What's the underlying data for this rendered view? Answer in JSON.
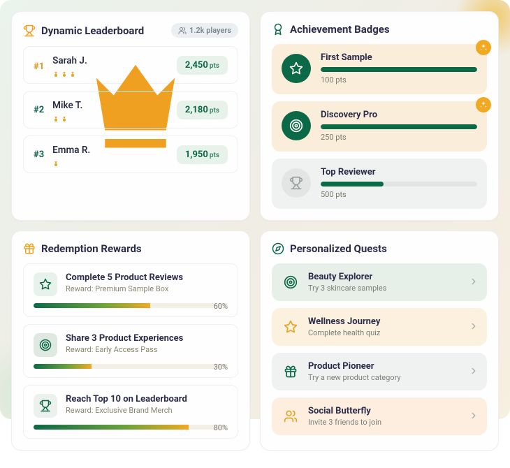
{
  "leaderboard": {
    "title": "Dynamic Leaderboard",
    "players_badge": "1.2k players",
    "pts_unit": "pts",
    "rows": [
      {
        "rank": "#1",
        "name": "Sarah J.",
        "points": "2,450",
        "medals": 3
      },
      {
        "rank": "#2",
        "name": "Mike T.",
        "points": "2,180",
        "medals": 2
      },
      {
        "rank": "#3",
        "name": "Emma R.",
        "points": "1,950",
        "medals": 1
      }
    ]
  },
  "achievements": {
    "title": "Achievement Badges",
    "items": [
      {
        "title": "First Sample",
        "points": "100 pts",
        "progress": 100,
        "claimed": true
      },
      {
        "title": "Discovery Pro",
        "points": "250 pts",
        "progress": 100,
        "claimed": true
      },
      {
        "title": "Top Reviewer",
        "points": "500 pts",
        "progress": 40,
        "claimed": false
      }
    ]
  },
  "rewards": {
    "title": "Redemption Rewards",
    "items": [
      {
        "title": "Complete 5 Product Reviews",
        "sub": "Reward: Premium Sample Box",
        "progress": 60,
        "pct": "60%"
      },
      {
        "title": "Share 3 Product Experiences",
        "sub": "Reward: Early Access Pass",
        "progress": 30,
        "pct": "30%"
      },
      {
        "title": "Reach Top 10 on Leaderboard",
        "sub": "Reward: Exclusive Brand Merch",
        "progress": 80,
        "pct": "80%"
      }
    ]
  },
  "quests": {
    "title": "Personalized Quests",
    "items": [
      {
        "title": "Beauty Explorer",
        "sub": "Try 3 skincare samples"
      },
      {
        "title": "Wellness Journey",
        "sub": "Complete health quiz"
      },
      {
        "title": "Product Pioneer",
        "sub": "Try a new product category"
      },
      {
        "title": "Social Butterfly",
        "sub": "Invite 3 friends to join"
      }
    ]
  }
}
